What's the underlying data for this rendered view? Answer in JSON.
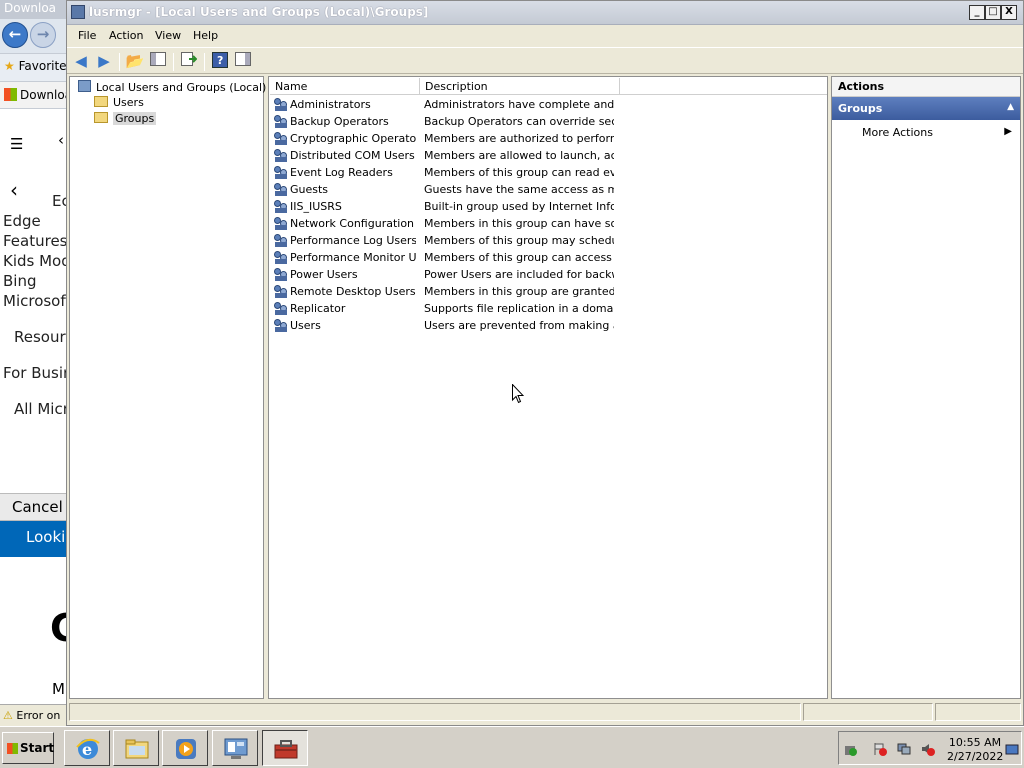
{
  "browser": {
    "title": "Downloa",
    "favorites": "Favorite",
    "tab": "Downloa",
    "lines": [
      "Ec",
      "Edge",
      "Features",
      "Kids Mod",
      "Bing",
      "Microsoft",
      "Resourc",
      "For Busin",
      "All Micr"
    ],
    "cancel": "Cancel",
    "looking": "Looki",
    "big_char": "C",
    "small_char": "M",
    "status": "Error on"
  },
  "window": {
    "title": "lusrmgr - [Local Users and Groups (Local)\\Groups]",
    "min": "_",
    "max": "□",
    "close": "X"
  },
  "menu": {
    "file": "File",
    "action": "Action",
    "view": "View",
    "help": "Help"
  },
  "tree": {
    "root": "Local Users and Groups (Local)",
    "users": "Users",
    "groups": "Groups"
  },
  "list": {
    "col_name": "Name",
    "col_desc": "Description",
    "rows": [
      {
        "name": "Administrators",
        "desc": "Administrators have complete and u..."
      },
      {
        "name": "Backup Operators",
        "desc": "Backup Operators can override secu..."
      },
      {
        "name": "Cryptographic Operators",
        "desc": "Members are authorized to perform ..."
      },
      {
        "name": "Distributed COM Users",
        "desc": "Members are allowed to launch, acti..."
      },
      {
        "name": "Event Log Readers",
        "desc": "Members of this group can read eve..."
      },
      {
        "name": "Guests",
        "desc": "Guests have the same access as me..."
      },
      {
        "name": "IIS_IUSRS",
        "desc": "Built-in group used by Internet Infor..."
      },
      {
        "name": "Network Configuration ...",
        "desc": "Members in this group can have som..."
      },
      {
        "name": "Performance Log Users",
        "desc": "Members of this group may schedule..."
      },
      {
        "name": "Performance Monitor U...",
        "desc": "Members of this group can access p..."
      },
      {
        "name": "Power Users",
        "desc": "Power Users are included for backw..."
      },
      {
        "name": "Remote Desktop Users",
        "desc": "Members in this group are granted t..."
      },
      {
        "name": "Replicator",
        "desc": "Supports file replication in a domain"
      },
      {
        "name": "Users",
        "desc": "Users are prevented from making ac..."
      }
    ]
  },
  "actions": {
    "header": "Actions",
    "section": "Groups",
    "more": "More Actions"
  },
  "taskbar": {
    "start": "Start",
    "time": "10:55 AM",
    "date": "2/27/2022"
  },
  "colors": {
    "accent": "#3c5c9e",
    "selection": "#d9d9d9"
  }
}
